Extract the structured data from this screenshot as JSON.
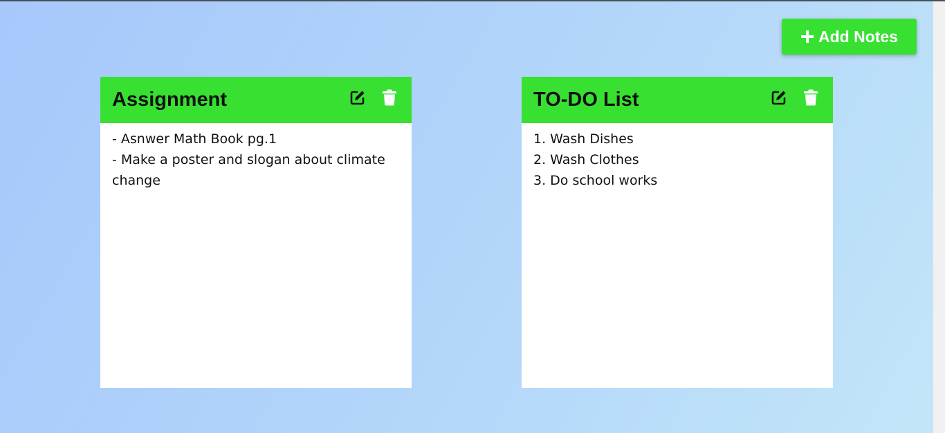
{
  "header": {
    "add_notes_label": "Add Notes",
    "add_icon": "plus-icon"
  },
  "colors": {
    "accent": "#38e032",
    "note_background": "#ffffff",
    "text": "#111111"
  },
  "notes": [
    {
      "title": "Assignment",
      "lines": [
        "- Asnwer Math Book pg.1",
        "- Make a poster and slogan about climate change"
      ],
      "edit_icon": "edit-icon",
      "delete_icon": "trash-icon"
    },
    {
      "title": "TO-DO List",
      "lines": [
        "1. Wash Dishes",
        "2. Wash Clothes",
        "3. Do school works"
      ],
      "edit_icon": "edit-icon",
      "delete_icon": "trash-icon"
    }
  ]
}
